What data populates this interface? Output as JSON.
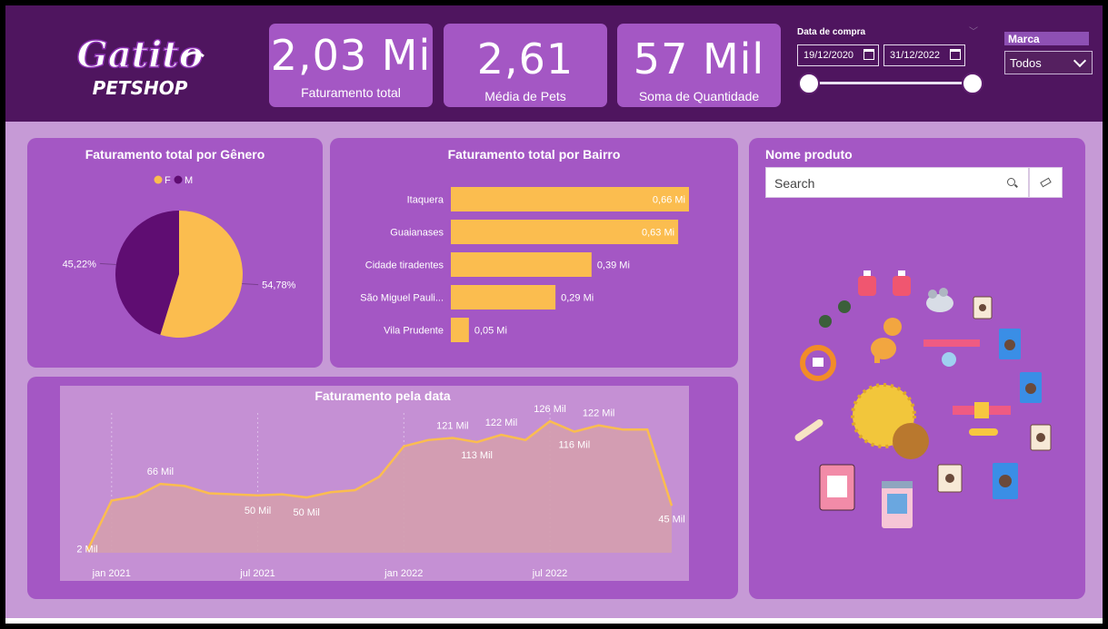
{
  "logo": {
    "line1": "Gatito",
    "line2": "PETSHOP"
  },
  "kpis": [
    {
      "value": "2,03 Mi",
      "label": "Faturamento total"
    },
    {
      "value": "2,61",
      "label": "Média de Pets"
    },
    {
      "value": "57 Mil",
      "label": "Soma de Quantidade"
    }
  ],
  "date_filter": {
    "title": "Data de compra",
    "start": "19/12/2020",
    "end": "31/12/2022"
  },
  "marca_filter": {
    "label": "Marca",
    "selected": "Todos"
  },
  "product_panel": {
    "title": "Nome produto",
    "search_placeholder": "Search"
  },
  "colors": {
    "header": "#4f155f",
    "card": "#a457c4",
    "accent": "#fbbd4f",
    "dark_purple": "#5f0d72",
    "background": "#c69ad6"
  },
  "chart_data": [
    {
      "type": "pie",
      "title": "Faturamento total por Gênero",
      "legend": [
        "F",
        "M"
      ],
      "labels": [
        "F",
        "M"
      ],
      "values": [
        54.78,
        45.22
      ],
      "value_labels": [
        "54,78%",
        "45,22%"
      ],
      "colors": [
        "#fbbd4f",
        "#5f0d72"
      ],
      "legend_position": "top"
    },
    {
      "type": "bar",
      "orientation": "horizontal",
      "title": "Faturamento total por Bairro",
      "categories": [
        "Itaquera",
        "Guaianases",
        "Cidade tiradentes",
        "São Miguel Pauli...",
        "Vila Prudente"
      ],
      "values": [
        0.66,
        0.63,
        0.39,
        0.29,
        0.05
      ],
      "value_labels": [
        "0,66 Mi",
        "0,63 Mi",
        "0,39 Mi",
        "0,29 Mi",
        "0,05 Mi"
      ],
      "xlim": [
        0,
        0.66
      ],
      "color": "#fbbd4f"
    },
    {
      "type": "area",
      "title": "Faturamento pela data",
      "x": [
        "2020-12",
        "2021-01",
        "2021-02",
        "2021-03",
        "2021-04",
        "2021-05",
        "2021-06",
        "2021-07",
        "2021-08",
        "2021-09",
        "2021-10",
        "2021-11",
        "2021-12",
        "2022-01",
        "2022-02",
        "2022-03",
        "2022-04",
        "2022-05",
        "2022-06",
        "2022-07",
        "2022-08",
        "2022-09",
        "2022-10",
        "2022-11",
        "2022-12"
      ],
      "values": [
        2,
        50,
        54,
        66,
        64,
        57,
        56,
        55,
        56,
        53,
        58,
        60,
        73,
        102,
        108,
        110,
        106,
        113,
        108,
        126,
        116,
        122,
        118,
        118,
        45
      ],
      "ylim": [
        0,
        140
      ],
      "x_ticks": [
        {
          "x": "2021-01",
          "label": "jan 2021"
        },
        {
          "x": "2021-07",
          "label": "jul 2021"
        },
        {
          "x": "2022-01",
          "label": "jan 2022"
        },
        {
          "x": "2022-07",
          "label": "jul 2022"
        }
      ],
      "annotations": [
        {
          "x": "2020-12",
          "label": "2 Mil"
        },
        {
          "x": "2021-03",
          "label": "66 Mil"
        },
        {
          "x": "2021-07",
          "label": "50 Mil"
        },
        {
          "x": "2021-09",
          "label": "50 Mil"
        },
        {
          "x": "2022-03",
          "label": "121 Mil"
        },
        {
          "x": "2022-04",
          "label": "113 Mil"
        },
        {
          "x": "2022-05",
          "label": "122 Mil"
        },
        {
          "x": "2022-07",
          "label": "126 Mil"
        },
        {
          "x": "2022-08",
          "label": "116 Mil"
        },
        {
          "x": "2022-09",
          "label": "122 Mil"
        },
        {
          "x": "2022-12",
          "label": "45 Mil"
        }
      ],
      "line_color": "#fbbd4f",
      "fill_color": "#d49fae",
      "grid": "vertical"
    }
  ]
}
